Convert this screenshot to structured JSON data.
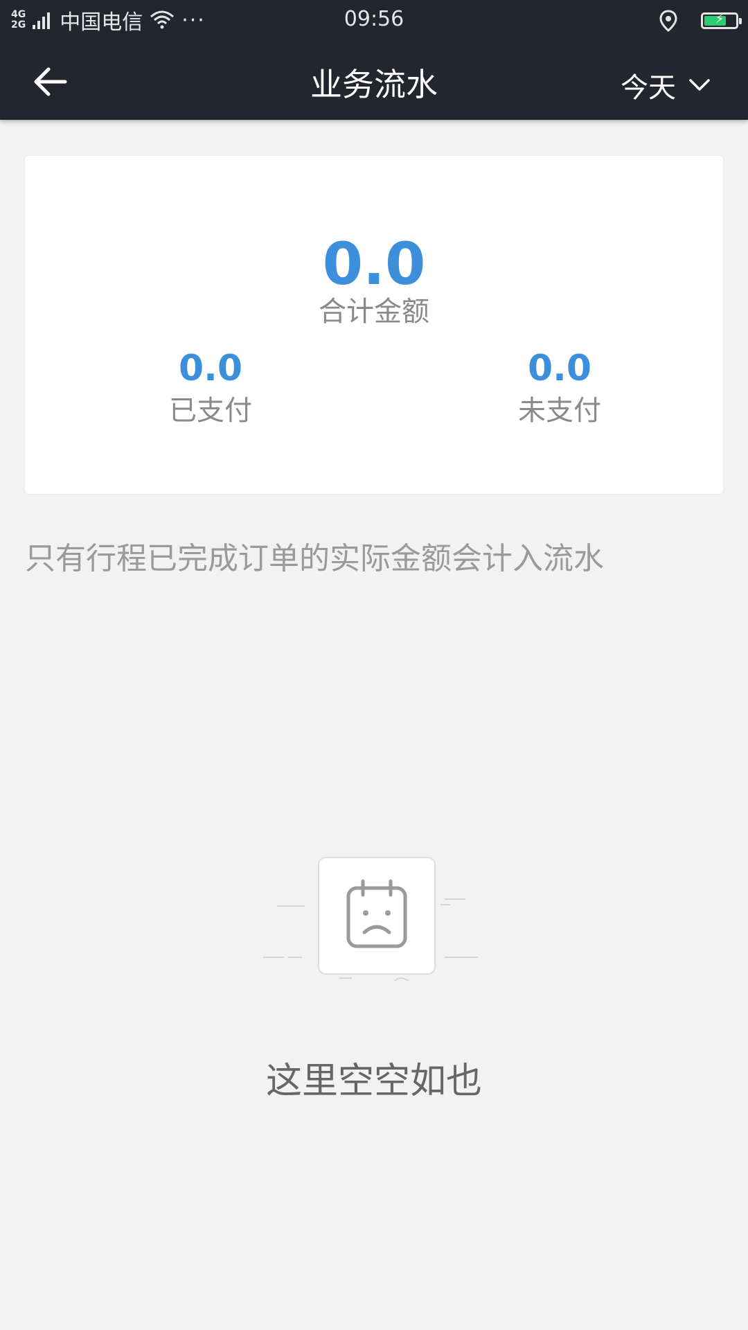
{
  "status_bar": {
    "network_top": "4G",
    "network_bottom": "2G",
    "carrier": "中国电信",
    "more": "···",
    "time": "09:56",
    "icons": [
      "signal-icon",
      "wifi-icon",
      "location-icon",
      "battery-charging-icon"
    ],
    "battery_level": 0.7,
    "battery_color": "#2ecc71"
  },
  "nav": {
    "back_icon": "arrow-left-icon",
    "title": "业务流水",
    "date_filter": "今天",
    "dropdown_icon": "chevron-down-icon"
  },
  "summary": {
    "total_value": "0.0",
    "total_label": "合计金额",
    "paid_value": "0.0",
    "paid_label": "已支付",
    "unpaid_value": "0.0",
    "unpaid_label": "未支付"
  },
  "note": "只有行程已完成订单的实际金额会计入流水",
  "empty_state": {
    "icon": "sad-calendar-icon",
    "text": "这里空空如也"
  },
  "colors": {
    "header_bg": "#23252f",
    "accent": "#3d8fdc",
    "page_bg": "#f2f2f2"
  }
}
